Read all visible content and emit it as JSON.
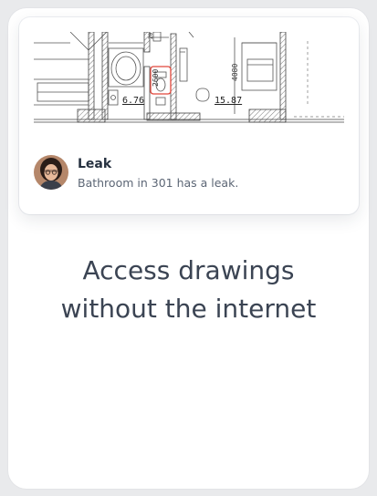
{
  "note": {
    "title": "Leak",
    "body": "Bathroom in 301 has a leak."
  },
  "drawing": {
    "labels": {
      "dimension_vertical_left": "2600",
      "dimension_vertical_right": "4080",
      "area_bathroom": "6.76",
      "area_room": "15.87",
      "small_top": "20"
    },
    "highlight_color": "#e0463a"
  },
  "headline": "Access drawings\nwithout the internet"
}
